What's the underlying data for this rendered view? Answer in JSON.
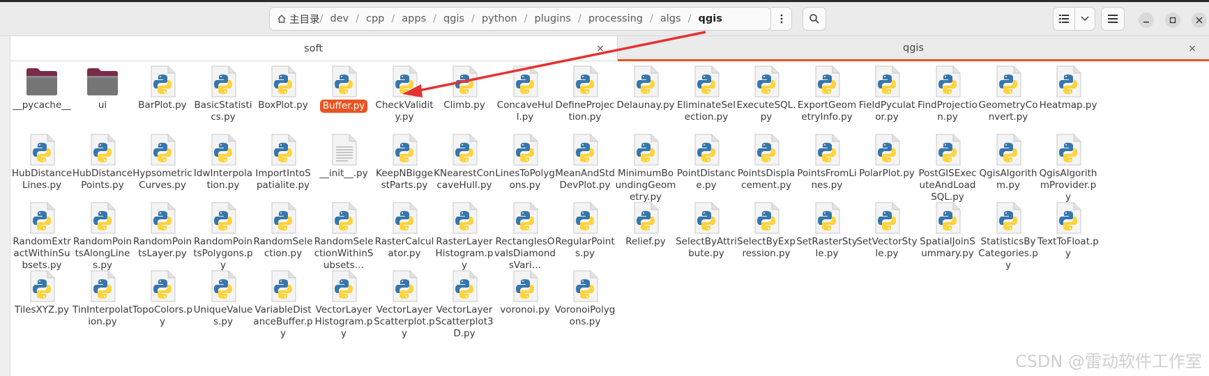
{
  "path": {
    "home": "主目录",
    "segments": [
      "dev",
      "cpp",
      "apps",
      "qgis",
      "python",
      "plugins",
      "processing",
      "algs",
      "qgis"
    ]
  },
  "tabs": [
    {
      "label": "soft",
      "close": "×"
    },
    {
      "label": "qgis",
      "close": "×"
    }
  ],
  "files": [
    {
      "name": "__pycache__",
      "type": "folder"
    },
    {
      "name": "ui",
      "type": "folder"
    },
    {
      "name": "BarPlot.py",
      "type": "py"
    },
    {
      "name": "BasicStatistics.py",
      "type": "py"
    },
    {
      "name": "BoxPlot.py",
      "type": "py"
    },
    {
      "name": "Buffer.py",
      "type": "py",
      "selected": true
    },
    {
      "name": "CheckValidity.py",
      "type": "py"
    },
    {
      "name": "Climb.py",
      "type": "py"
    },
    {
      "name": "ConcaveHull.py",
      "type": "py"
    },
    {
      "name": "DefineProjection.py",
      "type": "py"
    },
    {
      "name": "Delaunay.py",
      "type": "py"
    },
    {
      "name": "EliminateSelection.py",
      "type": "py"
    },
    {
      "name": "ExecuteSQL.py",
      "type": "py"
    },
    {
      "name": "ExportGeometryInfo.py",
      "type": "py"
    },
    {
      "name": "FieldPyculator.py",
      "type": "py"
    },
    {
      "name": "FindProjection.py",
      "type": "py"
    },
    {
      "name": "GeometryConvert.py",
      "type": "py"
    },
    {
      "name": "Heatmap.py",
      "type": "py"
    },
    {
      "name": "HubDistanceLines.py",
      "type": "py"
    },
    {
      "name": "HubDistancePoints.py",
      "type": "py"
    },
    {
      "name": "HypsometricCurves.py",
      "type": "py"
    },
    {
      "name": "IdwInterpolation.py",
      "type": "py"
    },
    {
      "name": "ImportIntoSpatialite.py",
      "type": "py"
    },
    {
      "name": "__init__.py",
      "type": "text"
    },
    {
      "name": "KeepNBiggestParts.py",
      "type": "py"
    },
    {
      "name": "KNearestConcaveHull.py",
      "type": "py"
    },
    {
      "name": "LinesToPolygons.py",
      "type": "py"
    },
    {
      "name": "MeanAndStdDevPlot.py",
      "type": "py"
    },
    {
      "name": "MinimumBoundingGeometry.py",
      "type": "py"
    },
    {
      "name": "PointDistance.py",
      "type": "py"
    },
    {
      "name": "PointsDisplacement.py",
      "type": "py"
    },
    {
      "name": "PointsFromLines.py",
      "type": "py"
    },
    {
      "name": "PolarPlot.py",
      "type": "py"
    },
    {
      "name": "PostGISExecuteAndLoadSQL.py",
      "type": "py"
    },
    {
      "name": "QgisAlgorithm.py",
      "type": "py"
    },
    {
      "name": "QgisAlgorithmProvider.py",
      "type": "py"
    },
    {
      "name": "RandomExtractWithinSubsets.py",
      "type": "py"
    },
    {
      "name": "RandomPointsAlongLines.py",
      "type": "py"
    },
    {
      "name": "RandomPointsLayer.py",
      "type": "py"
    },
    {
      "name": "RandomPointsPolygons.py",
      "type": "py"
    },
    {
      "name": "RandomSelection.py",
      "type": "py"
    },
    {
      "name": "RandomSelectionWithinSubsets…",
      "type": "py"
    },
    {
      "name": "RasterCalculator.py",
      "type": "py"
    },
    {
      "name": "RasterLayerHistogram.py",
      "type": "py"
    },
    {
      "name": "RectanglesOvalsDiamondsVari…",
      "type": "py"
    },
    {
      "name": "RegularPoints.py",
      "type": "py"
    },
    {
      "name": "Relief.py",
      "type": "py"
    },
    {
      "name": "SelectByAttribute.py",
      "type": "py"
    },
    {
      "name": "SelectByExpression.py",
      "type": "py"
    },
    {
      "name": "SetRasterStyle.py",
      "type": "py"
    },
    {
      "name": "SetVectorStyle.py",
      "type": "py"
    },
    {
      "name": "SpatialJoinSummary.py",
      "type": "py"
    },
    {
      "name": "StatisticsByCategories.py",
      "type": "py"
    },
    {
      "name": "TextToFloat.py",
      "type": "py"
    },
    {
      "name": "TilesXYZ.py",
      "type": "py"
    },
    {
      "name": "TinInterpolation.py",
      "type": "py"
    },
    {
      "name": "TopoColors.py",
      "type": "py"
    },
    {
      "name": "UniqueValues.py",
      "type": "py"
    },
    {
      "name": "VariableDistanceBuffer.py",
      "type": "py"
    },
    {
      "name": "VectorLayerHistogram.py",
      "type": "py"
    },
    {
      "name": "VectorLayerScatterplot.py",
      "type": "py"
    },
    {
      "name": "VectorLayerScatterplot3D.py",
      "type": "py"
    },
    {
      "name": "voronoi.py",
      "type": "py"
    },
    {
      "name": "VoronoiPolygons.py",
      "type": "py"
    }
  ],
  "watermark": "CSDN @雷动软件工作室",
  "colors": {
    "accent": "#e95420",
    "annotation": "#e63232"
  }
}
